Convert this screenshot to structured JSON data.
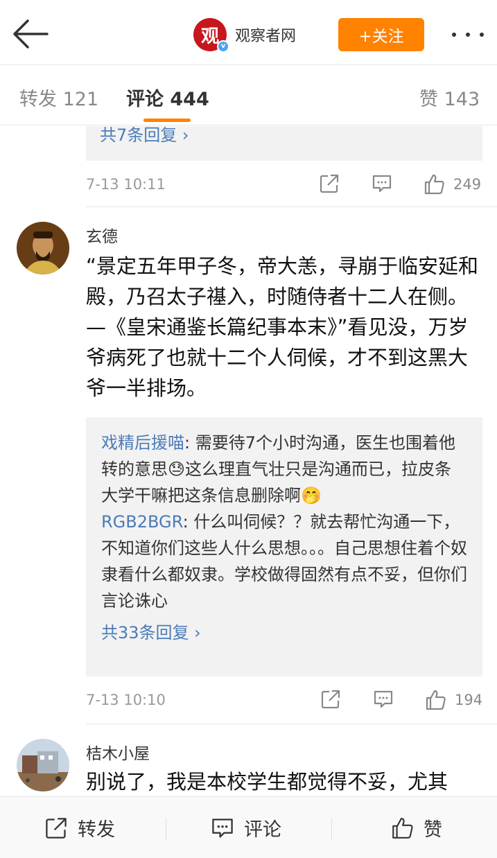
{
  "header": {
    "account_name": "观察者网",
    "logo_char": "观",
    "verified_badge": "v",
    "follow_label": "+关注"
  },
  "tabs": {
    "repost": "转发 121",
    "comment": "评论 444",
    "like": "赞 143"
  },
  "comments": [
    {
      "replies_total": "共7条回复 ›",
      "time": "7-13 10:11",
      "like_count": "249"
    },
    {
      "username": "玄德",
      "text": "“景定五年甲子冬，帝大恙，寻崩于临安延和殿，乃召太子禥入，时随侍者十二人在侧。—《皇宋通鉴长篇纪事本末》”看见没，万岁爷病死了也就十二个人伺候，才不到这黑大爷一半排场。",
      "replies": [
        {
          "user": "戏精后援喵",
          "text": ": 需要待7个小时沟通，医生也围着他转的意思😓这么理直气壮只是沟通而已，拉皮条大学干嘛把这条信息删除啊🤭"
        },
        {
          "user": "RGB2BGR",
          "text": ": 什么叫伺候？？就去帮忙沟通一下，不知道你们这些人什么思想。。。自己思想住着个奴隶看什么都奴隶。学校做得固然有点不妥，但你们言论诛心"
        }
      ],
      "replies_total": "共33条回复 ›",
      "time": "7-13 10:10",
      "like_count": "194"
    },
    {
      "username": "桔木小屋",
      "text": "别说了，我是本校学生都觉得不妥，尤其"
    }
  ],
  "bottom_bar": {
    "repost": "转发",
    "comment": "评论",
    "like": "赞"
  },
  "colors": {
    "accent": "#ff8200",
    "link": "#4b7bb8",
    "brand_red": "#c8161d"
  },
  "icons": [
    "back-arrow-icon",
    "verified-icon",
    "more-icon",
    "share-icon",
    "comment-icon",
    "like-icon"
  ]
}
